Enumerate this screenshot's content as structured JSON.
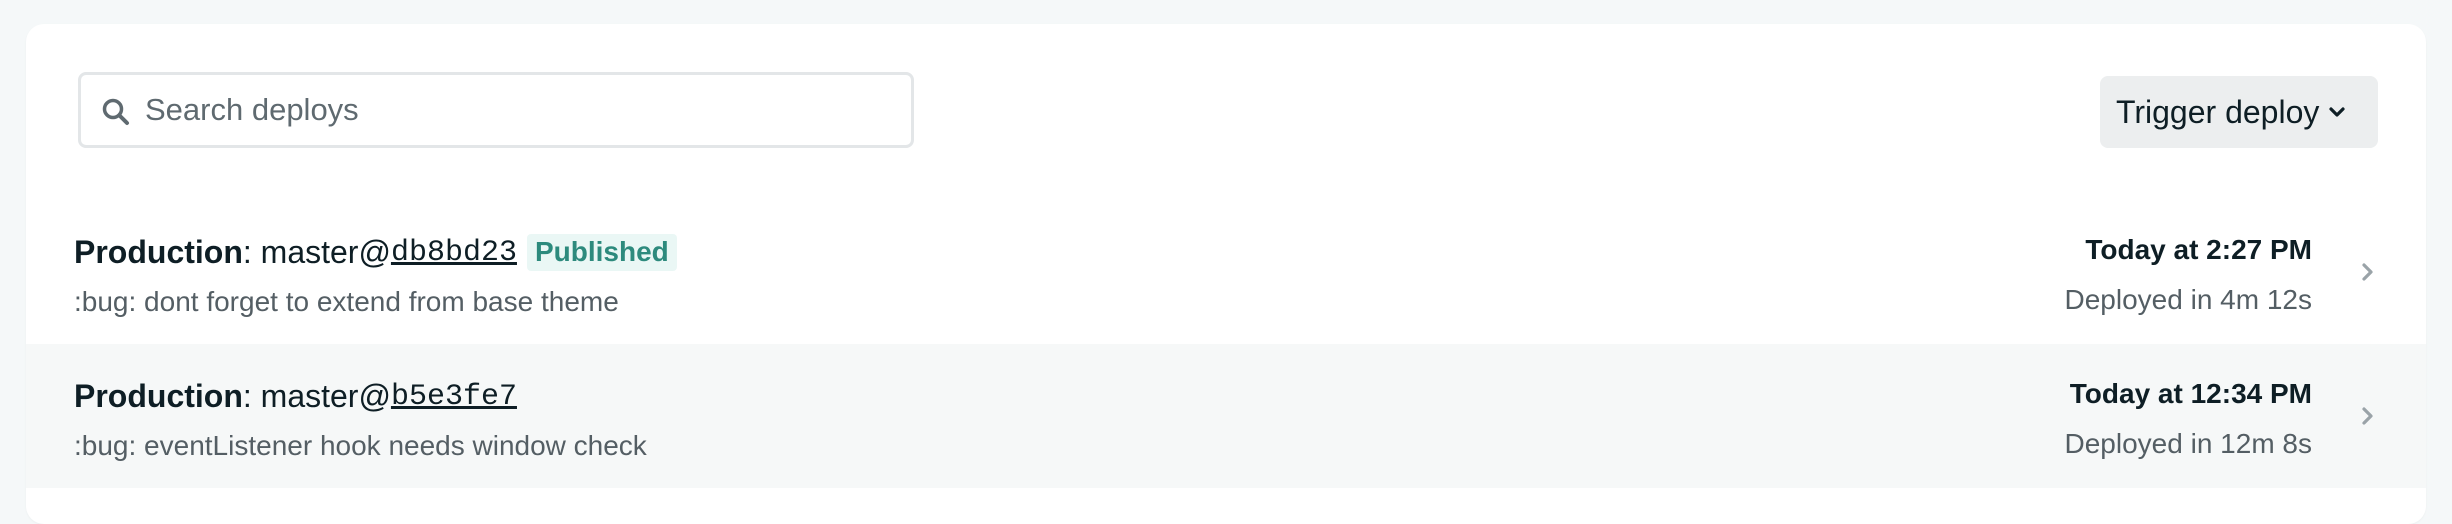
{
  "search": {
    "placeholder": "Search deploys",
    "value": ""
  },
  "toolbar": {
    "trigger_label": "Trigger deploy"
  },
  "deploys": [
    {
      "context": "Production",
      "separator": ": ",
      "branch": "master@",
      "sha": "db8bd23",
      "badge": "Published",
      "message": ":bug: dont forget to extend from base theme",
      "time": "Today at 2:27 PM",
      "duration": "Deployed in 4m 12s"
    },
    {
      "context": "Production",
      "separator": ": ",
      "branch": "master@",
      "sha": "b5e3fe7",
      "badge": "",
      "message": ":bug: eventListener hook needs window check",
      "time": "Today at 12:34 PM",
      "duration": "Deployed in 12m 8s"
    }
  ],
  "icons": {
    "search": "search-icon",
    "trigger": "chevron-down-icon",
    "row": "chevron-right-icon"
  },
  "colors": {
    "page_background": "#f5f8f9",
    "card_background": "#ffffff",
    "alt_row_background": "#f6f8f8",
    "badge_background": "#eaf7f5",
    "badge_text": "#2d8a7d",
    "button_background": "#eceeef",
    "muted_text": "#545e64"
  }
}
